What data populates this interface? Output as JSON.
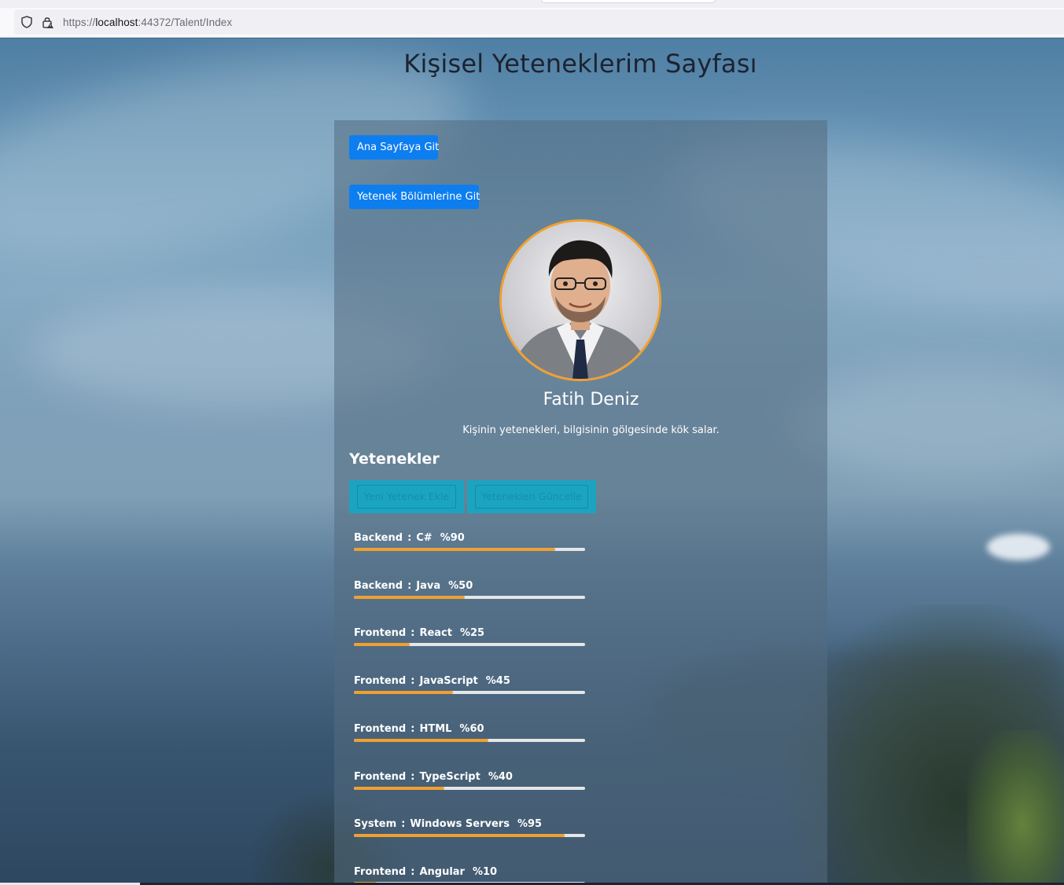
{
  "browser": {
    "url_prefix": "https://",
    "url_host": "localhost",
    "url_rest": ":44372/Talent/Index"
  },
  "page": {
    "title": "Kişisel Yeteneklerim Sayfası"
  },
  "card": {
    "home_button": "Ana Sayfaya Git",
    "sections_button": "Yetenek Bölümlerine Git",
    "profile_name": "Fatih Deniz",
    "quote": "Kişinin yetenekleri, bilgisinin gölgesinde kök salar.",
    "skills_heading": "Yetenekler",
    "add_skill_button": "Yeni Yetenek Ekle",
    "update_skills_button": "Yetenekleri Güncelle"
  },
  "skills": [
    {
      "category": "Backend",
      "name": "C#",
      "percent_label": "%90",
      "level": 0.87
    },
    {
      "category": "Backend",
      "name": "Java",
      "percent_label": "%50",
      "level": 0.48
    },
    {
      "category": "Frontend",
      "name": "React",
      "percent_label": "%25",
      "level": 0.24
    },
    {
      "category": "Frontend",
      "name": "JavaScript",
      "percent_label": "%45",
      "level": 0.43
    },
    {
      "category": "Frontend",
      "name": "HTML",
      "percent_label": "%60",
      "level": 0.58
    },
    {
      "category": "Frontend",
      "name": "TypeScript",
      "percent_label": "%40",
      "level": 0.39
    },
    {
      "category": "System",
      "name": "Windows Servers",
      "percent_label": "%95",
      "level": 0.91
    },
    {
      "category": "Frontend",
      "name": "Angular",
      "percent_label": "%10",
      "level": 0.1
    }
  ],
  "colors": {
    "accent_orange": "#f0a030",
    "primary_button": "#0d7ef0",
    "teal_button": "#1ba4c0"
  }
}
